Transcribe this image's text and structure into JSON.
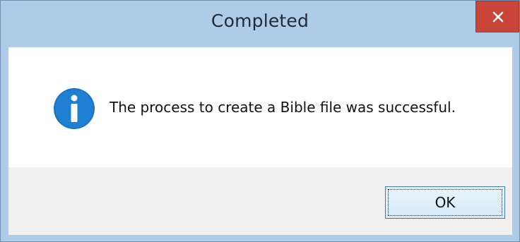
{
  "window": {
    "title": "Completed"
  },
  "dialog": {
    "message": "The process to create a Bible file was successful.",
    "icon": "info-icon",
    "ok_label": "OK"
  },
  "colors": {
    "titlebar": "#aecbe8",
    "close_button": "#c9453a",
    "info_icon": "#1a73c6",
    "footer": "#f0f0f0"
  }
}
